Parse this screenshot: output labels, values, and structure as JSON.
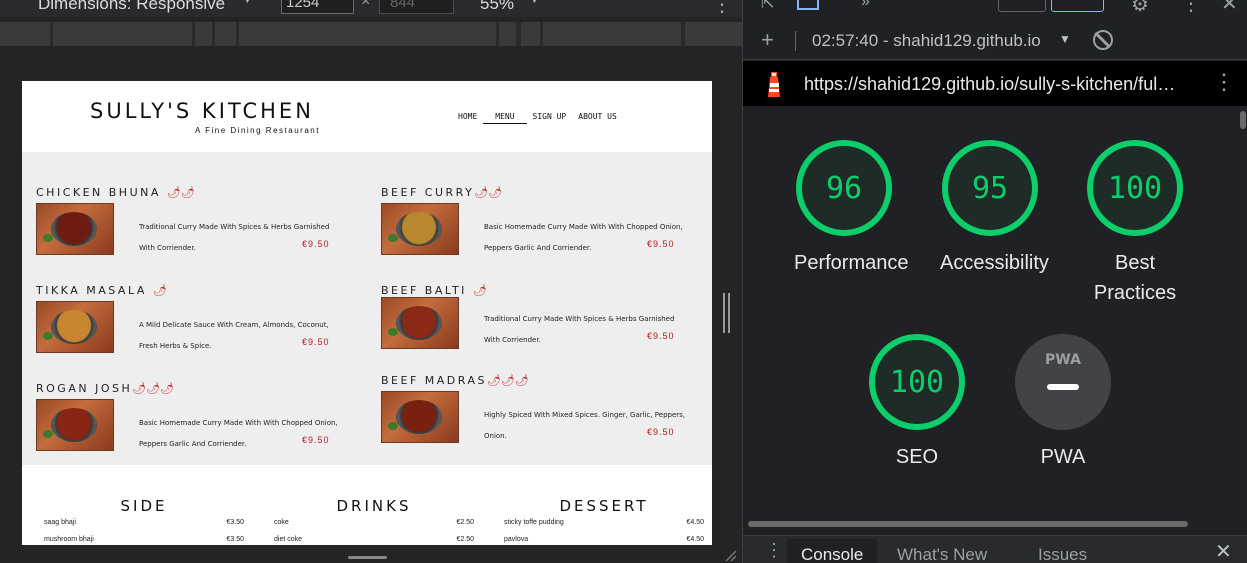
{
  "device_toolbar": {
    "dimensions_label": "Dimensions: Responsive",
    "width_value": "1254",
    "height_placeholder": "844",
    "times": "×",
    "zoom_label": "55%"
  },
  "site": {
    "logo": "SULLY'S KITCHEN",
    "tagline": "A Fine Dining Restaurant",
    "nav": [
      "HOME",
      "MENU",
      "SIGN UP",
      "ABOUT US"
    ],
    "dishes": [
      {
        "title": "CHICKEN BHUNA",
        "chili": "🌶🌶",
        "desc": "Traditional Curry Made With Spices & Herbs Garnished With Corriender.",
        "price": "€9.50",
        "sauce": "#6e1c12"
      },
      {
        "title": "BEEF CURRY",
        "chili": "🌶🌶",
        "desc": "Basic Homemade Curry Made With With Chopped Onion, Peppers Garlic And Corriender.",
        "price": "€9.50",
        "sauce": "#b8872e"
      },
      {
        "title": "TIKKA MASALA",
        "chili": "🌶",
        "desc": "A Mild Delicate Sauce With Cream, Almonds, Coconut, Fresh Herbs & Spice.",
        "price": "€9.50",
        "sauce": "#c7862f"
      },
      {
        "title": "BEEF BALTI",
        "chili": "🌶",
        "desc": "Traditional Curry Made With Spices & Herbs Garnished With Corriender.",
        "price": "€9.50",
        "sauce": "#8a2a16"
      },
      {
        "title": "ROGAN JOSH",
        "chili": "🌶🌶🌶",
        "desc": "Basic Homemade Curry Made With With Chopped Onion, Peppers Garlic And Corriender.",
        "price": "€9.50",
        "sauce": "#8a2414"
      },
      {
        "title": "BEEF MADRAS",
        "chili": "🌶🌶🌶",
        "desc": "Highly Spiced With Mixed Spices. Ginger, Garlic, Peppers, Onion.",
        "price": "€9.50",
        "sauce": "#7a2010"
      }
    ],
    "extras": [
      {
        "head": "SIDE",
        "items": [
          {
            "name": "saag bhaji",
            "price": "€3.50"
          },
          {
            "name": "mushroom bhaji",
            "price": "€3.50"
          }
        ]
      },
      {
        "head": "DRINKS",
        "items": [
          {
            "name": "coke",
            "price": "€2.50"
          },
          {
            "name": "diet coke",
            "price": "€2.50"
          }
        ]
      },
      {
        "head": "DESSERT",
        "items": [
          {
            "name": "sticky toffe pudding",
            "price": "€4.50"
          },
          {
            "name": "pavlova",
            "price": "€4.50"
          }
        ]
      }
    ]
  },
  "devtools": {
    "report_select": "02:57:40 - shahid129.github.io",
    "url": "https://shahid129.github.io/sully-s-kitchen/ful…",
    "scores": [
      {
        "value": "96",
        "label": "Performance"
      },
      {
        "value": "95",
        "label": "Accessibility"
      },
      {
        "value": "100",
        "label": "Best Practices"
      },
      {
        "value": "100",
        "label": "SEO"
      }
    ],
    "pwa": {
      "badge": "PWA",
      "label": "PWA"
    },
    "drawer_tabs": [
      "Console",
      "What's New",
      "Issues"
    ],
    "accent": "#0cce6b"
  }
}
